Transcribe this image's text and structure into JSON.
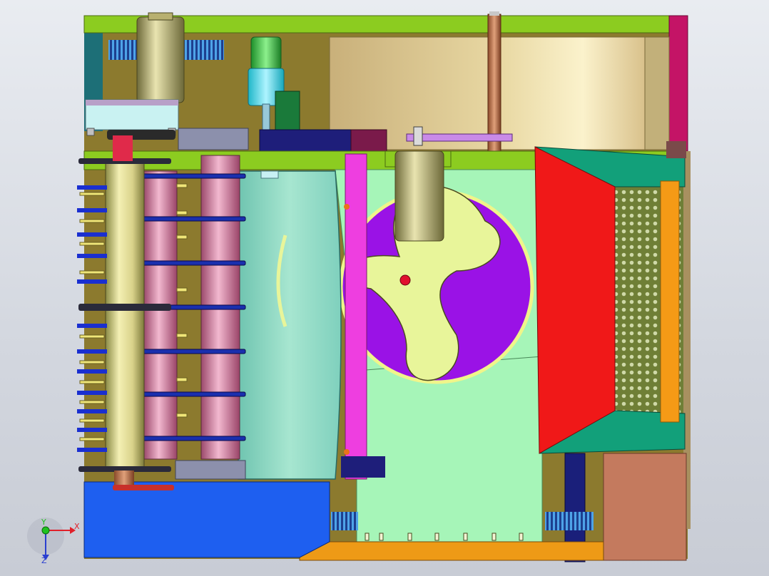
{
  "viewport": {
    "background_top": "#e9ecf1",
    "background_bottom": "#c8ccd5"
  },
  "triad": {
    "x_label": "X",
    "y_label": "Y",
    "z_label": "Z",
    "x_color": "#e0202a",
    "y_color": "#1fc21f",
    "z_color": "#2a3fd0"
  },
  "colors": {
    "frame_green": "#8ccc20",
    "magenta_post": "#c41466",
    "blue_base": "#1e5ff0",
    "orange_base": "#ee9a16",
    "rotor_purple": "#9a12e6",
    "rotor_lobes": "#e8f59a",
    "mint_housing": "#a6f5b8",
    "red_panel": "#f01818",
    "teal_panel": "#12a07a",
    "pink_cylinders": "#d77aa0",
    "gold_roller": "#e8e29a",
    "navy_shaft": "#1a1f7a",
    "pink_post": "#ee3ee0",
    "olive_back": "#8c7a2e",
    "salmon_block": "#c47a5e"
  }
}
